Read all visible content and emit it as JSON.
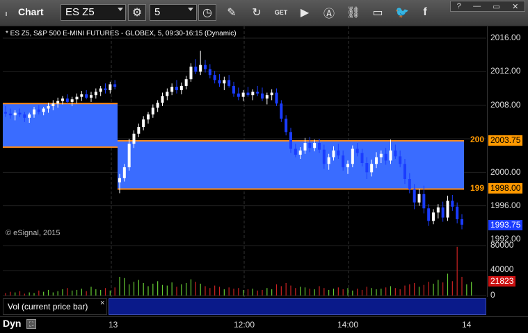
{
  "toolbar": {
    "title": "Chart",
    "symbol_value": "ES Z5",
    "interval_value": "5",
    "icons": [
      "gear-icon",
      "clock-icon",
      "pencil-icon",
      "refresh-icon",
      "get-icon",
      "play-icon",
      "alert-icon",
      "link-icon",
      "comment-icon",
      "twitter-icon",
      "facebook-icon"
    ]
  },
  "chart": {
    "header": "* ES Z5, S&P 500 E-MINI FUTURES - GLOBEX, 5, 09:30-16:15 (Dynamic)",
    "copyright": "© eSignal, 2015"
  },
  "price_axis": {
    "labels": [
      "2016.00",
      "2012.00",
      "2008.00",
      "2000.00",
      "1996.00",
      "1992.00"
    ],
    "tags": [
      {
        "text": "2003.75",
        "color": "#ff9900",
        "bg": "#ff9900",
        "fg": "#000"
      },
      {
        "text": "1998.00",
        "color": "#ff9900",
        "bg": "#ff9900",
        "fg": "#000"
      },
      {
        "text": "1993.75",
        "bg": "#1a3cff",
        "fg": "#fff"
      }
    ],
    "left_tags": [
      "200",
      "199"
    ]
  },
  "volume": {
    "label": "Vol (current price bar)",
    "close": "×",
    "axis_labels": [
      "80000",
      "40000",
      "0"
    ],
    "current": "21823"
  },
  "time_axis": {
    "mode": "Dyn",
    "labels": [
      "13",
      "12:00",
      "14:00",
      "14"
    ]
  },
  "colors": {
    "band": "#3a6cff",
    "orange": "#ff8c1a",
    "up": "#ffffff",
    "down": "#1a3cff",
    "vol_up": "#66cc33",
    "vol_down": "#cc2222"
  },
  "chart_data": {
    "type": "candlestick",
    "ylim": [
      1992,
      2018
    ],
    "zones": [
      {
        "x_start": 0,
        "x_end": 24,
        "top": 2008.2,
        "bottom": 2003.0
      },
      {
        "x_start": 24,
        "x_end": 100,
        "top": 2003.75,
        "bottom": 1998.0
      }
    ],
    "candles": [
      [
        2007.2,
        2007.9,
        2006.6,
        2007.0
      ],
      [
        2007.0,
        2007.6,
        2006.4,
        2006.8
      ],
      [
        2006.8,
        2007.4,
        2006.2,
        2007.1
      ],
      [
        2007.1,
        2007.6,
        2006.6,
        2006.9
      ],
      [
        2006.9,
        2007.2,
        2006.0,
        2006.5
      ],
      [
        2006.5,
        2007.1,
        2005.9,
        2006.9
      ],
      [
        2006.9,
        2007.8,
        2006.5,
        2007.5
      ],
      [
        2007.5,
        2008.0,
        2006.9,
        2007.2
      ],
      [
        2007.2,
        2007.8,
        2006.8,
        2007.6
      ],
      [
        2007.6,
        2008.3,
        2007.1,
        2007.9
      ],
      [
        2007.9,
        2008.6,
        2007.4,
        2008.2
      ],
      [
        2008.2,
        2008.9,
        2007.7,
        2008.5
      ],
      [
        2008.5,
        2009.1,
        2008.1,
        2008.8
      ],
      [
        2008.8,
        2009.3,
        2008.2,
        2008.4
      ],
      [
        2008.4,
        2009.0,
        2007.9,
        2008.7
      ],
      [
        2008.7,
        2009.4,
        2008.2,
        2009.0
      ],
      [
        2009.0,
        2009.7,
        2008.5,
        2009.3
      ],
      [
        2009.3,
        2009.8,
        2008.7,
        2008.9
      ],
      [
        2008.9,
        2009.6,
        2008.4,
        2009.2
      ],
      [
        2009.2,
        2010.0,
        2008.8,
        2009.6
      ],
      [
        2009.6,
        2010.3,
        2009.1,
        2010.0
      ],
      [
        2010.0,
        2010.6,
        2009.4,
        2009.8
      ],
      [
        2009.8,
        2010.8,
        2009.4,
        2010.5
      ],
      [
        2010.5,
        2011.0,
        2009.9,
        2010.2
      ],
      [
        1998.8,
        1999.8,
        1997.5,
        1999.3
      ],
      [
        1999.3,
        2001.0,
        1998.9,
        2000.6
      ],
      [
        2000.6,
        2004.0,
        2000.2,
        2003.4
      ],
      [
        2003.4,
        2005.0,
        2002.9,
        2004.6
      ],
      [
        2004.6,
        2005.8,
        2004.2,
        2005.4
      ],
      [
        2005.4,
        2006.7,
        2005.0,
        2006.3
      ],
      [
        2006.3,
        2007.2,
        2005.8,
        2006.9
      ],
      [
        2006.9,
        2008.1,
        2006.5,
        2007.7
      ],
      [
        2007.7,
        2008.6,
        2007.2,
        2008.3
      ],
      [
        2008.3,
        2009.5,
        2007.9,
        2009.1
      ],
      [
        2009.1,
        2010.0,
        2008.6,
        2009.6
      ],
      [
        2009.6,
        2010.6,
        2009.2,
        2010.2
      ],
      [
        2010.2,
        2011.0,
        2009.4,
        2009.8
      ],
      [
        2009.8,
        2010.7,
        2009.3,
        2010.3
      ],
      [
        2010.3,
        2011.5,
        2009.9,
        2011.1
      ],
      [
        2011.1,
        2013.0,
        2010.8,
        2012.6
      ],
      [
        2012.6,
        2013.5,
        2011.7,
        2012.0
      ],
      [
        2012.0,
        2014.5,
        2011.6,
        2012.8
      ],
      [
        2012.8,
        2013.4,
        2011.9,
        2012.3
      ],
      [
        2012.3,
        2012.9,
        2011.2,
        2011.6
      ],
      [
        2011.6,
        2012.1,
        2010.6,
        2011.0
      ],
      [
        2011.0,
        2011.7,
        2010.2,
        2010.6
      ],
      [
        2010.6,
        2011.4,
        2009.8,
        2011.0
      ],
      [
        2011.0,
        2011.6,
        2010.1,
        2010.3
      ],
      [
        2010.3,
        2010.8,
        2009.0,
        2009.4
      ],
      [
        2009.4,
        2010.1,
        2008.6,
        2009.0
      ],
      [
        2009.0,
        2009.8,
        2008.5,
        2009.5
      ],
      [
        2009.5,
        2010.2,
        2009.0,
        2009.2
      ],
      [
        2009.2,
        2009.9,
        2008.6,
        2009.6
      ],
      [
        2009.6,
        2010.3,
        2009.1,
        2009.4
      ],
      [
        2009.4,
        2010.1,
        2008.5,
        2008.8
      ],
      [
        2008.8,
        2009.5,
        2008.1,
        2009.2
      ],
      [
        2009.2,
        2009.9,
        2008.6,
        2009.5
      ],
      [
        2009.5,
        2010.0,
        2007.9,
        2008.2
      ],
      [
        2008.2,
        2008.6,
        2006.0,
        2006.4
      ],
      [
        2006.4,
        2006.8,
        2004.4,
        2004.8
      ],
      [
        2004.8,
        2005.3,
        2002.3,
        2002.8
      ],
      [
        2002.8,
        2003.4,
        2001.8,
        2002.1
      ],
      [
        2002.1,
        2003.0,
        2001.6,
        2002.6
      ],
      [
        2002.6,
        2004.1,
        2002.2,
        2003.5
      ],
      [
        2003.5,
        2004.2,
        2002.4,
        2002.9
      ],
      [
        2002.9,
        2003.9,
        2002.5,
        2003.5
      ],
      [
        2003.5,
        2004.0,
        2002.3,
        2002.7
      ],
      [
        2002.7,
        2003.3,
        2000.4,
        2001.0
      ],
      [
        2001.0,
        2002.2,
        2000.3,
        2001.8
      ],
      [
        2001.8,
        2003.1,
        2001.4,
        2002.6
      ],
      [
        2002.6,
        2003.4,
        2001.6,
        2002.0
      ],
      [
        2002.0,
        2002.6,
        2000.2,
        2000.6
      ],
      [
        2000.6,
        2001.4,
        1999.8,
        2001.0
      ],
      [
        2001.0,
        2003.2,
        2000.6,
        2002.8
      ],
      [
        2002.8,
        2003.5,
        2001.9,
        2002.3
      ],
      [
        2002.3,
        2002.8,
        2000.7,
        2001.1
      ],
      [
        2001.1,
        2001.8,
        1999.2,
        2000.0
      ],
      [
        2000.0,
        2001.5,
        1999.5,
        2001.0
      ],
      [
        2001.0,
        2002.4,
        2000.5,
        2001.8
      ],
      [
        2001.8,
        2002.6,
        2001.1,
        2002.2
      ],
      [
        2002.2,
        2002.9,
        2000.9,
        2001.4
      ],
      [
        2001.4,
        2003.9,
        2001.0,
        2002.6
      ],
      [
        2002.6,
        2003.3,
        2001.6,
        2001.9
      ],
      [
        2001.9,
        2002.6,
        2000.6,
        2001.0
      ],
      [
        2001.0,
        2001.6,
        1998.6,
        1999.2
      ],
      [
        1999.2,
        1999.9,
        1997.5,
        1998.0
      ],
      [
        1998.0,
        1998.6,
        1995.6,
        1996.4
      ],
      [
        1996.4,
        1998.0,
        1996.0,
        1997.4
      ],
      [
        1997.4,
        1998.4,
        1995.1,
        1995.7
      ],
      [
        1995.7,
        1996.2,
        1993.6,
        1994.2
      ],
      [
        1994.2,
        1995.6,
        1993.8,
        1995.2
      ],
      [
        1995.2,
        1996.2,
        1994.5,
        1995.8
      ],
      [
        1995.8,
        1996.5,
        1994.1,
        1994.6
      ],
      [
        1994.6,
        1997.2,
        1994.2,
        1996.6
      ],
      [
        1996.6,
        1997.3,
        1995.4,
        1995.9
      ],
      [
        1995.9,
        1996.4,
        1993.9,
        1994.4
      ],
      [
        1994.4,
        1995.0,
        1993.2,
        1993.75
      ]
    ],
    "volume": [
      4,
      6,
      5,
      7,
      3,
      5,
      4,
      8,
      6,
      9,
      5,
      7,
      10,
      12,
      8,
      9,
      11,
      7,
      14,
      10,
      9,
      12,
      8,
      13,
      30,
      28,
      18,
      22,
      25,
      20,
      15,
      19,
      23,
      17,
      16,
      21,
      14,
      18,
      20,
      26,
      22,
      19,
      15,
      12,
      16,
      14,
      10,
      13,
      11,
      12,
      9,
      10,
      11,
      8,
      9,
      12,
      10,
      18,
      15,
      20,
      16,
      12,
      14,
      13,
      11,
      10,
      15,
      12,
      9,
      11,
      13,
      10,
      12,
      8,
      11,
      9,
      14,
      12,
      10,
      11,
      13,
      15,
      12,
      10,
      16,
      18,
      20,
      14,
      17,
      22,
      19,
      25,
      21,
      35,
      23,
      78,
      30,
      18,
      21.8
    ]
  }
}
